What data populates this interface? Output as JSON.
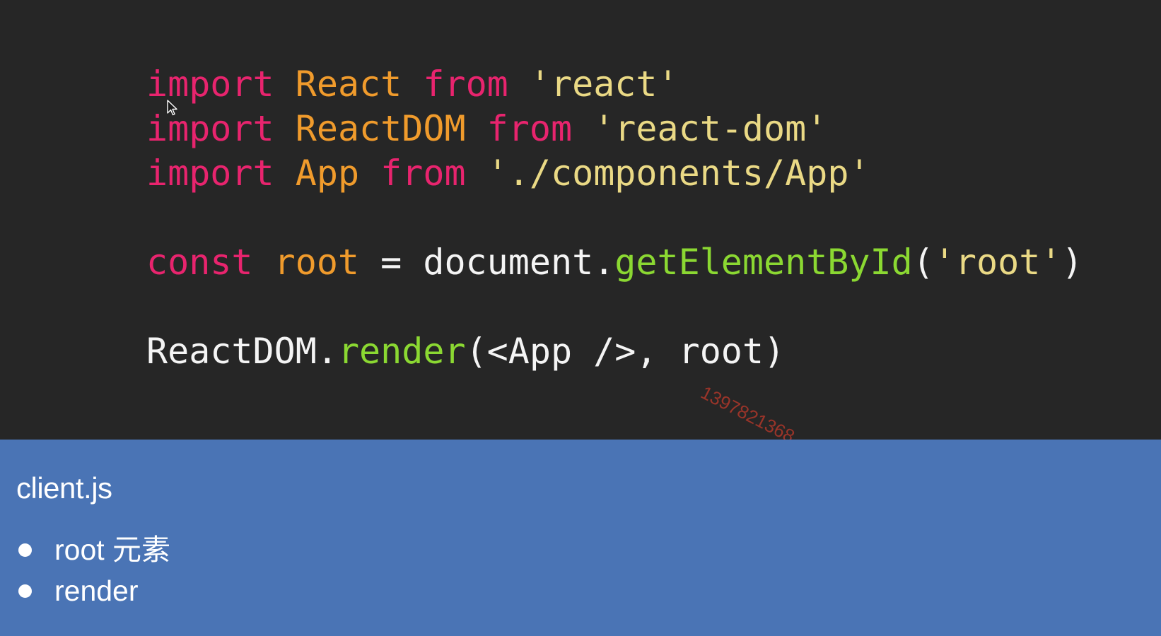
{
  "code": {
    "lines": [
      [
        {
          "t": "import",
          "c": "kw"
        },
        {
          "t": " ",
          "c": "pl"
        },
        {
          "t": "React",
          "c": "id"
        },
        {
          "t": " ",
          "c": "pl"
        },
        {
          "t": "from",
          "c": "kw"
        },
        {
          "t": " ",
          "c": "pl"
        },
        {
          "t": "'react'",
          "c": "str"
        }
      ],
      [
        {
          "t": "import",
          "c": "kw"
        },
        {
          "t": " ",
          "c": "pl"
        },
        {
          "t": "ReactDOM",
          "c": "id"
        },
        {
          "t": " ",
          "c": "pl"
        },
        {
          "t": "from",
          "c": "kw"
        },
        {
          "t": " ",
          "c": "pl"
        },
        {
          "t": "'react-dom'",
          "c": "str"
        }
      ],
      [
        {
          "t": "import",
          "c": "kw"
        },
        {
          "t": " ",
          "c": "pl"
        },
        {
          "t": "App",
          "c": "id"
        },
        {
          "t": " ",
          "c": "pl"
        },
        {
          "t": "from",
          "c": "kw"
        },
        {
          "t": " ",
          "c": "pl"
        },
        {
          "t": "'./components/App'",
          "c": "str"
        }
      ],
      [],
      [
        {
          "t": "const",
          "c": "kw"
        },
        {
          "t": " ",
          "c": "pl"
        },
        {
          "t": "root",
          "c": "id"
        },
        {
          "t": " = document.",
          "c": "pl"
        },
        {
          "t": "getElementById",
          "c": "fn"
        },
        {
          "t": "(",
          "c": "pl"
        },
        {
          "t": "'root'",
          "c": "str"
        },
        {
          "t": ")",
          "c": "pl"
        }
      ],
      [],
      [
        {
          "t": "ReactDOM.",
          "c": "pl"
        },
        {
          "t": "render",
          "c": "fn"
        },
        {
          "t": "(<App />, root)",
          "c": "pl"
        }
      ]
    ]
  },
  "watermark": "13978213​68",
  "panel": {
    "title": "client.js",
    "bullets": [
      "root 元素",
      "render"
    ]
  },
  "colors": {
    "keyword": "#e8246e",
    "identifier": "#f09b2c",
    "string": "#ead985",
    "function": "#8bd832",
    "plain": "#f4f4f4",
    "panel_bg": "#4a74b5",
    "code_bg": "#262626"
  },
  "icons": {
    "cursor": "mouse-pointer-icon"
  }
}
